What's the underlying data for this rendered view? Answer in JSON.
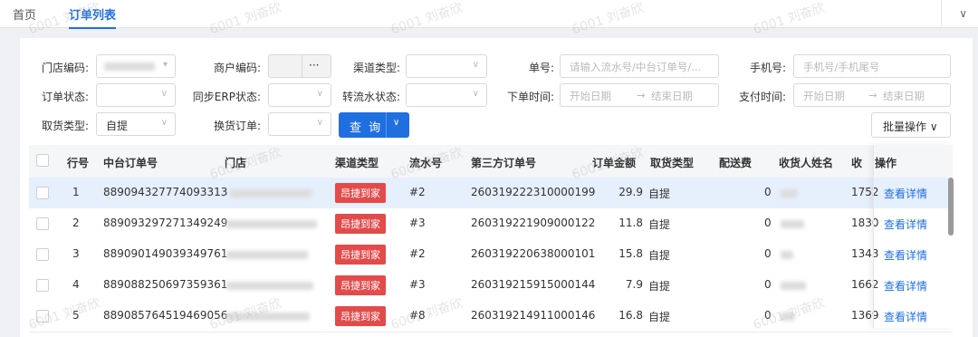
{
  "tabs": [
    {
      "label": "首页"
    },
    {
      "label": "订单列表"
    }
  ],
  "watermark": "6001 刘奋欣",
  "filters": {
    "store_code": {
      "label": "门店编码:"
    },
    "merchant_code": {
      "label": "商户编码:",
      "action": "···"
    },
    "channel_type": {
      "label": "渠道类型:"
    },
    "order_no": {
      "label": "单号:",
      "placeholder": "请输入流水号/中台订单号/..."
    },
    "phone": {
      "label": "手机号:",
      "placeholder": "手机号/手机尾号"
    },
    "order_status": {
      "label": "订单状态:"
    },
    "erp_status": {
      "label": "同步ERP状态:"
    },
    "transfer_status": {
      "label": "转流水状态:"
    },
    "order_time": {
      "label": "下单时间:",
      "start": "开始日期",
      "arrow": "→",
      "end": "结束日期"
    },
    "pay_time": {
      "label": "支付时间:",
      "start": "开始日期",
      "arrow": "→",
      "end": "结束日期"
    },
    "pickup_type": {
      "label": "取货类型:",
      "value": "自提"
    },
    "exchange_order": {
      "label": "换货订单:"
    }
  },
  "buttons": {
    "query": "查 询",
    "batch": "批量操作 ∨"
  },
  "table": {
    "headers": [
      "行号",
      "中台订单号",
      "门店",
      "渠道类型",
      "流水号",
      "第三方订单号",
      "订单金额",
      "取货类型",
      "配送费",
      "收货人姓名",
      "收",
      "操作"
    ],
    "rows": [
      {
        "no": "1",
        "order": "889094327774093313",
        "channel": "昂捷到家",
        "serial": "#2",
        "third": "260319222310000199",
        "amount": "29.9",
        "pickup": "自提",
        "fee": "0",
        "recv": "1752",
        "action": "查看详情"
      },
      {
        "no": "2",
        "order": "889093297271349249",
        "channel": "昂捷到家",
        "serial": "#3",
        "third": "260319221909000122",
        "amount": "11.8",
        "pickup": "自提",
        "fee": "0",
        "recv": "1830",
        "action": "查看详情"
      },
      {
        "no": "3",
        "order": "889090149039349761",
        "channel": "昂捷到家",
        "serial": "#2",
        "third": "260319220638000101",
        "amount": "15.8",
        "pickup": "自提",
        "fee": "0",
        "recv": "1343",
        "action": "查看详情"
      },
      {
        "no": "4",
        "order": "889088250697359361",
        "channel": "昂捷到家",
        "serial": "#3",
        "third": "260319215915000144",
        "amount": "7.9",
        "pickup": "自提",
        "fee": "0",
        "recv": "1662",
        "action": "查看详情"
      },
      {
        "no": "5",
        "order": "889085764519469056",
        "channel": "昂捷到家",
        "serial": "#8",
        "third": "260319214911000146",
        "amount": "16.8",
        "pickup": "自提",
        "fee": "0",
        "recv": "1369",
        "action": "查看详情"
      }
    ]
  }
}
